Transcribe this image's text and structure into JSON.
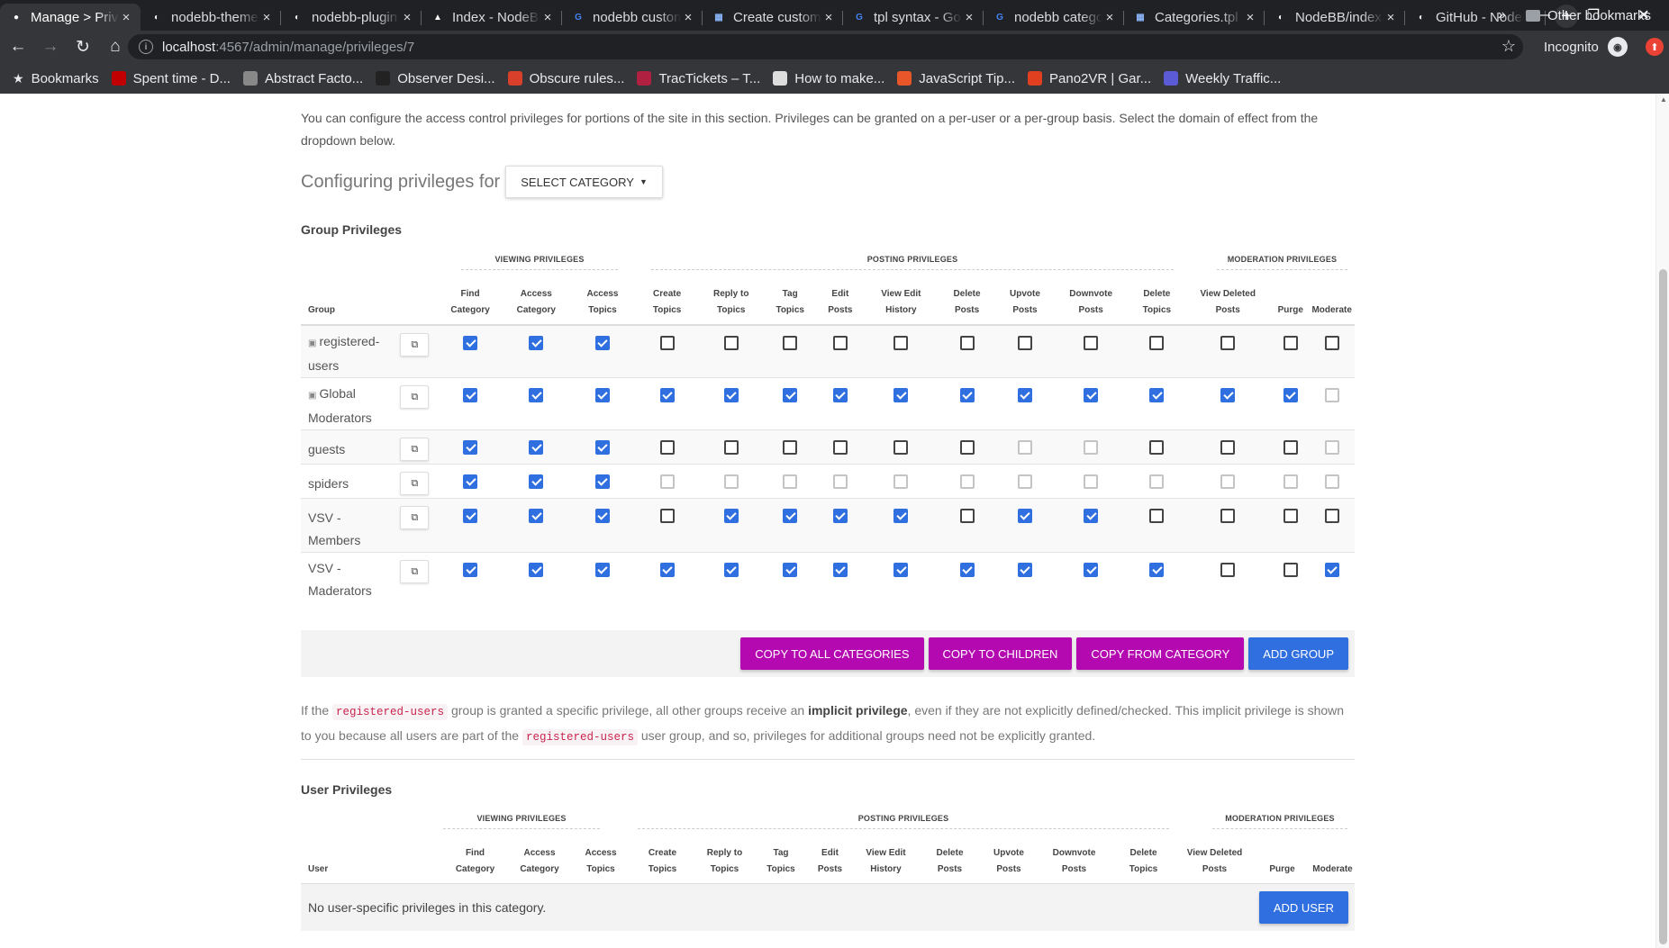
{
  "browser": {
    "tabs": [
      {
        "title": "Manage > Privileges",
        "icon": "dot-icon",
        "icon_color": "#ffffff"
      },
      {
        "title": "nodebb-theme",
        "icon": "github-icon",
        "icon_color": "#ffffff"
      },
      {
        "title": "nodebb-plugin",
        "icon": "github-icon",
        "icon_color": "#ffffff"
      },
      {
        "title": "Index - NodeBB",
        "icon": "cap-icon",
        "icon_color": "#ffffff"
      },
      {
        "title": "nodebb custom",
        "icon": "google-icon",
        "icon_color": "#4285f4"
      },
      {
        "title": "Create custom",
        "icon": "page-icon",
        "icon_color": "#8ab4f8"
      },
      {
        "title": "tpl syntax - Google",
        "icon": "google-icon",
        "icon_color": "#4285f4"
      },
      {
        "title": "nodebb category",
        "icon": "google-icon",
        "icon_color": "#4285f4"
      },
      {
        "title": "Categories.tpl",
        "icon": "page-icon",
        "icon_color": "#8ab4f8"
      },
      {
        "title": "NodeBB/index",
        "icon": "github-icon",
        "icon_color": "#ffffff"
      },
      {
        "title": "GitHub - NodeBB",
        "icon": "github-icon",
        "icon_color": "#ffffff"
      }
    ],
    "url_host": "localhost",
    "url_path": ":4567/admin/manage/privileges/7",
    "incognito_label": "Incognito",
    "bookmarks_label": "Bookmarks",
    "bookmarks": [
      {
        "label": "Spent time - D...",
        "color": "#c00000"
      },
      {
        "label": "Abstract Facto...",
        "color": "#888888"
      },
      {
        "label": "Observer Desi...",
        "color": "#222222"
      },
      {
        "label": "Obscure rules...",
        "color": "#d8402b"
      },
      {
        "label": "TracTickets – T...",
        "color": "#b02040"
      },
      {
        "label": "How to make...",
        "color": "#dddddd"
      },
      {
        "label": "JavaScript Tip...",
        "color": "#e8562a"
      },
      {
        "label": "Pano2VR | Gar...",
        "color": "#e04020"
      },
      {
        "label": "Weekly Traffic...",
        "color": "#5b5bd6"
      }
    ],
    "other_bookmarks": "Other bookmarks"
  },
  "page": {
    "intro": "You can configure the access control privileges for portions of the site in this section. Privileges can be granted on a per-user or a per-group basis. Select the domain of effect from the dropdown below.",
    "configuring_label": "Configuring privileges for",
    "select_category": "SELECT CATEGORY",
    "group_title": "Group Privileges",
    "user_title": "User Privileges",
    "sections": {
      "viewing": "VIEWING PRIVILEGES",
      "posting": "POSTING PRIVILEGES",
      "moderation": "MODERATION PRIVILEGES"
    },
    "group_col": "Group",
    "user_col": "User",
    "columns": [
      [
        "Find",
        "Category"
      ],
      [
        "Access",
        "Category"
      ],
      [
        "Access",
        "Topics"
      ],
      [
        "Create",
        "Topics"
      ],
      [
        "Reply to",
        "Topics"
      ],
      [
        "Tag",
        "Topics"
      ],
      [
        "Edit",
        "Posts"
      ],
      [
        "View Edit",
        "History"
      ],
      [
        "Delete",
        "Posts"
      ],
      [
        "Upvote",
        "Posts"
      ],
      [
        "Downvote",
        "Posts"
      ],
      [
        "Delete",
        "Topics"
      ],
      [
        "View Deleted",
        "Posts"
      ],
      [
        "Purge",
        ""
      ],
      [
        "Moderate",
        ""
      ]
    ],
    "groups": [
      {
        "name": "registered-users",
        "locked": true,
        "checked": [
          1,
          1,
          1,
          0,
          0,
          0,
          0,
          0,
          0,
          0,
          0,
          0,
          0,
          0,
          0
        ],
        "disabled": [
          0,
          0,
          0,
          0,
          0,
          0,
          0,
          0,
          0,
          0,
          0,
          0,
          0,
          0,
          0
        ]
      },
      {
        "name": "Global Moderators",
        "locked": true,
        "checked": [
          1,
          1,
          1,
          1,
          1,
          1,
          1,
          1,
          1,
          1,
          1,
          1,
          1,
          1,
          0
        ],
        "disabled": [
          0,
          0,
          0,
          0,
          0,
          0,
          0,
          0,
          0,
          0,
          0,
          0,
          0,
          0,
          1
        ]
      },
      {
        "name": "guests",
        "locked": false,
        "checked": [
          1,
          1,
          1,
          0,
          0,
          0,
          0,
          0,
          0,
          0,
          0,
          0,
          0,
          0,
          0
        ],
        "disabled": [
          0,
          0,
          0,
          0,
          0,
          0,
          0,
          0,
          0,
          1,
          1,
          0,
          0,
          0,
          1
        ]
      },
      {
        "name": "spiders",
        "locked": false,
        "checked": [
          1,
          1,
          1,
          0,
          0,
          0,
          0,
          0,
          0,
          0,
          0,
          0,
          0,
          0,
          0
        ],
        "disabled": [
          0,
          0,
          0,
          1,
          1,
          1,
          1,
          1,
          1,
          1,
          1,
          1,
          1,
          1,
          1
        ]
      },
      {
        "name": "VSV - Members",
        "locked": false,
        "checked": [
          1,
          1,
          1,
          0,
          1,
          1,
          1,
          1,
          0,
          1,
          1,
          0,
          0,
          0,
          0
        ],
        "disabled": [
          0,
          0,
          0,
          0,
          0,
          0,
          0,
          0,
          0,
          0,
          0,
          0,
          0,
          0,
          0
        ]
      },
      {
        "name": "VSV - Maderators",
        "locked": false,
        "checked": [
          1,
          1,
          1,
          1,
          1,
          1,
          1,
          1,
          1,
          1,
          1,
          1,
          0,
          0,
          1
        ],
        "disabled": [
          0,
          0,
          0,
          0,
          0,
          0,
          0,
          0,
          0,
          0,
          0,
          0,
          0,
          0,
          0
        ]
      }
    ],
    "buttons": {
      "copy_all": "Copy to all Categories",
      "copy_children": "Copy to Children",
      "copy_from": "Copy from Category",
      "add_group": "Add Group",
      "add_user": "Add User"
    },
    "note": {
      "p1": "If the",
      "code": "registered-users",
      "p2": "group is granted a specific privilege, all other groups receive an",
      "bold": "implicit privilege",
      "p3": ", even if they are not explicitly defined/checked. This implicit privilege is shown to you because all users are part of the",
      "p4": "user group, and so, privileges for additional groups need not be explicitly granted."
    },
    "no_users": "No user-specific privileges in this category.",
    "colors": {
      "checkbox": "#2f6fe0",
      "magenta_button": "#b408b0",
      "blue_button": "#2f6fe0"
    }
  }
}
